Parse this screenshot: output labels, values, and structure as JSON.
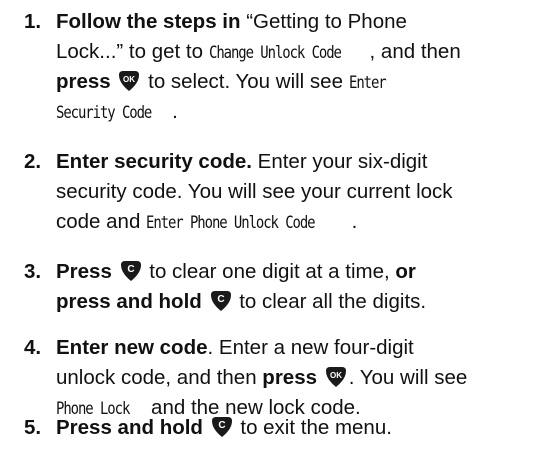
{
  "steps": [
    {
      "number": "1.",
      "lines": [
        [
          {
            "text": "Follow the steps in",
            "bold": true
          },
          {
            "text": " “Getting to Phone"
          }
        ],
        [
          {
            "text": "Lock...” to get to "
          },
          {
            "text": "Change Unlock Code",
            "lcd": true
          },
          {
            "text": ", and then"
          }
        ],
        [
          {
            "text": "press",
            "bold": true
          },
          {
            "text": " "
          },
          {
            "key": "ok"
          },
          {
            "text": " to select. You will see "
          },
          {
            "text": "Enter",
            "lcd": true
          }
        ],
        [
          {
            "text": "Security Code",
            "lcd": true
          },
          {
            "text": "."
          }
        ]
      ]
    },
    {
      "number": "2.",
      "lines": [
        [
          {
            "text": "Enter security code.",
            "bold": true
          },
          {
            "text": " Enter your six-digit"
          }
        ],
        [
          {
            "text": "security code. You will see your current lock"
          }
        ],
        [
          {
            "text": "code and "
          },
          {
            "text": "Enter Phone Unlock Code",
            "lcd": true
          },
          {
            "text": "."
          }
        ]
      ]
    },
    {
      "number": "3.",
      "lines": [
        [
          {
            "text": "Press",
            "bold": true
          },
          {
            "text": " "
          },
          {
            "key": "c"
          },
          {
            "text": " to clear one digit at a time, "
          },
          {
            "text": "or",
            "bold": true
          }
        ],
        [
          {
            "text": "press and hold",
            "bold": true
          },
          {
            "text": " "
          },
          {
            "key": "c"
          },
          {
            "text": " to clear all the digits."
          }
        ]
      ]
    },
    {
      "number": "4.",
      "lines": [
        [
          {
            "text": "Enter new code",
            "bold": true
          },
          {
            "text": ". Enter a new four-digit"
          }
        ],
        [
          {
            "text": "unlock code, and then "
          },
          {
            "text": "press",
            "bold": true
          },
          {
            "text": " "
          },
          {
            "key": "ok"
          },
          {
            "text": ". You will see"
          }
        ],
        [
          {
            "text": "Phone Lock",
            "lcd": true
          },
          {
            "text": " and the new lock code."
          }
        ]
      ]
    },
    {
      "number": "5.",
      "lines": [
        [
          {
            "text": "Press and hold",
            "bold": true
          },
          {
            "text": " "
          },
          {
            "key": "c"
          },
          {
            "text": " to exit the menu."
          }
        ]
      ]
    }
  ],
  "keys": {
    "ok": {
      "label": "OK",
      "icon": "ok-key-icon",
      "color": "#1a1a1a"
    },
    "c": {
      "label": "C",
      "icon": "clear-key-icon",
      "color": "#1a1a1a"
    }
  }
}
